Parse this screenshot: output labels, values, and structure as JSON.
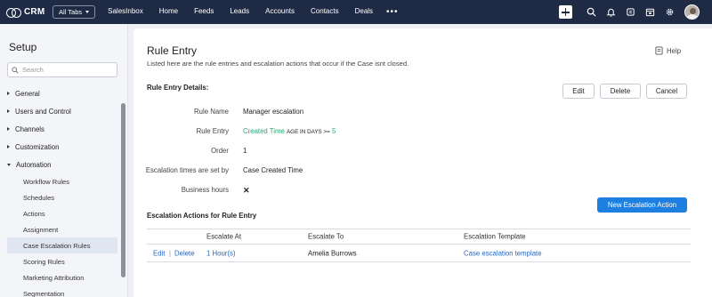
{
  "app": {
    "name": "CRM",
    "all_tabs_label": "All Tabs"
  },
  "nav": {
    "tabs": [
      "SalesInbox",
      "Home",
      "Feeds",
      "Leads",
      "Accounts",
      "Contacts",
      "Deals"
    ],
    "more": "•••"
  },
  "topbar_icons": [
    "add-icon",
    "search-icon",
    "bell-icon",
    "feedback-icon",
    "calendar-icon",
    "gear-icon",
    "user-avatar"
  ],
  "sidebar": {
    "title": "Setup",
    "search_placeholder": "Search",
    "categories": [
      {
        "label": "General",
        "expanded": false
      },
      {
        "label": "Users and Control",
        "expanded": false
      },
      {
        "label": "Channels",
        "expanded": false
      },
      {
        "label": "Customization",
        "expanded": false
      },
      {
        "label": "Automation",
        "expanded": true
      }
    ],
    "automation_items": [
      "Workflow Rules",
      "Schedules",
      "Actions",
      "Assignment",
      "Case Escalation Rules",
      "Scoring Rules",
      "Marketing Attribution",
      "Segmentation"
    ],
    "active_item": "Case Escalation Rules"
  },
  "main": {
    "title": "Rule Entry",
    "description": "Listed here are the rule entries and escalation actions that occur if the Case isnt closed.",
    "help_label": "Help",
    "details_title": "Rule Entry Details:",
    "buttons": {
      "edit": "Edit",
      "delete": "Delete",
      "cancel": "Cancel"
    },
    "details": {
      "rule_name_label": "Rule Name",
      "rule_name_value": "Manager escalation",
      "rule_entry_label": "Rule Entry",
      "rule_entry_field": "Created Time",
      "rule_entry_criteria": "AGE IN DAYS >=",
      "rule_entry_value": "5",
      "order_label": "Order",
      "order_value": "1",
      "escalation_times_label": "Escalation times are set by",
      "escalation_times_value": "Case Created Time",
      "business_hours_label": "Business hours",
      "business_hours_value": "✕"
    },
    "actions_title": "Escalation Actions for Rule Entry",
    "new_action_button": "New Escalation Action",
    "table": {
      "headers": [
        "Escalate At",
        "Escalate To",
        "Escalation Template"
      ],
      "rows": [
        {
          "edit": "Edit",
          "separator": "|",
          "delete": "Delete",
          "escalate_at": "1 Hour(s)",
          "escalate_to": "Amelia Burrows",
          "template": "Case escalation template"
        }
      ]
    }
  },
  "colors": {
    "topbar": "#1f2a44",
    "primary": "#1d7fe0",
    "green": "#2aa776",
    "link": "#2667c2",
    "error": "#e0302c"
  }
}
